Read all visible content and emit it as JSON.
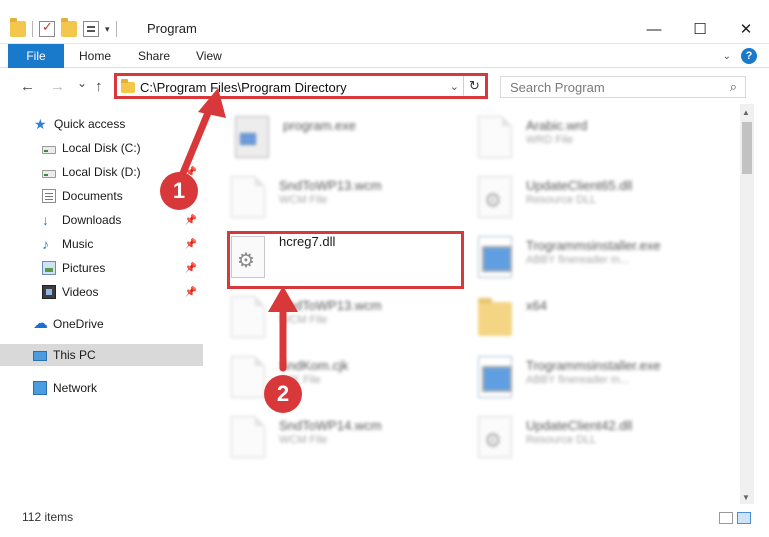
{
  "window": {
    "title": "Program",
    "min_glyph": "—",
    "max_glyph": "☐",
    "close_glyph": "✕"
  },
  "ribbon": {
    "tabs": [
      "File",
      "Home",
      "Share",
      "View"
    ],
    "help_glyph": "?"
  },
  "nav": {
    "back_glyph": "←",
    "forward_glyph": "→",
    "recent_glyph": "⌄",
    "up_glyph": "↑",
    "address_path": "C:\\Program Files\\Program Directory",
    "address_dropdown_glyph": "⌄",
    "refresh_glyph": "↻",
    "search_placeholder": "Search Program",
    "search_glyph": "⌕"
  },
  "sidebar": {
    "items": [
      {
        "label": "Quick access",
        "icon": "star-icon"
      },
      {
        "label": "Local Disk (C:)",
        "icon": "disk-icon"
      },
      {
        "label": "Local Disk (D:)",
        "icon": "disk-icon"
      },
      {
        "label": "Documents",
        "icon": "documents-icon"
      },
      {
        "label": "Downloads",
        "icon": "downloads-icon"
      },
      {
        "label": "Music",
        "icon": "music-icon"
      },
      {
        "label": "Pictures",
        "icon": "pictures-icon"
      },
      {
        "label": "Videos",
        "icon": "videos-icon"
      },
      {
        "label": "OneDrive",
        "icon": "onedrive-icon"
      },
      {
        "label": "This PC",
        "icon": "this-pc-icon",
        "selected": true
      },
      {
        "label": "Network",
        "icon": "network-icon"
      }
    ]
  },
  "files": [
    {
      "name": "program.exe",
      "type": ""
    },
    {
      "name": "Arabic.wrd",
      "type": "WRD File"
    },
    {
      "name": "SndToWP13.wcm",
      "type": "WCM File"
    },
    {
      "name": "UpdateClient65.dll",
      "type": "Resource DLL"
    },
    {
      "name": "hcreg7.dll",
      "type": ""
    },
    {
      "name": "Trogrammsinstaller.exe",
      "type": "ABBY finereader m..."
    },
    {
      "name": "SndToWP13.wcm",
      "type": "WCM File"
    },
    {
      "name": "x64",
      "type": ""
    },
    {
      "name": "SndKom.cjk",
      "type": "CJK File"
    },
    {
      "name": "Trogrammsinstaller.exe",
      "type": "ABBY finereader m..."
    },
    {
      "name": "SndToWP14.wcm",
      "type": "WCM File"
    },
    {
      "name": "UpdateClient42.dll",
      "type": "Resource DLL"
    }
  ],
  "status": {
    "item_count": "112 items"
  },
  "annotations": {
    "marker1": "1",
    "marker2": "2",
    "color": "#d9383a"
  }
}
